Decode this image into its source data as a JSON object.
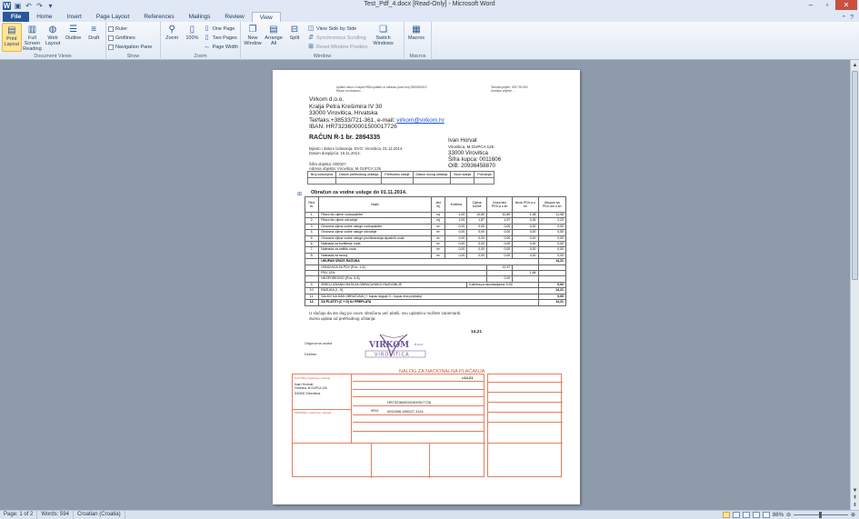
{
  "window": {
    "title": "Test_Pdf_4.docx [Read-Only] - Microsoft Word"
  },
  "tabs": [
    {
      "label": "File"
    },
    {
      "label": "Home"
    },
    {
      "label": "Insert"
    },
    {
      "label": "Page Layout"
    },
    {
      "label": "References"
    },
    {
      "label": "Mailings"
    },
    {
      "label": "Review"
    },
    {
      "label": "View"
    }
  ],
  "ribbon": {
    "document_views": {
      "label": "Document Views",
      "print_layout": "Print Layout",
      "full_screen": "Full Screen Reading",
      "web_layout": "Web Layout",
      "outline": "Outline",
      "draft": "Draft"
    },
    "show": {
      "label": "Show",
      "ruler": "Ruler",
      "gridlines": "Gridlines",
      "navigation": "Navigation Pane"
    },
    "zoom": {
      "label": "Zoom",
      "zoom": "Zoom",
      "percent": "100%",
      "one_page": "One Page",
      "two_pages": "Two Pages",
      "page_width": "Page Width"
    },
    "window": {
      "label": "Window",
      "new_window": "New Window",
      "arrange_all": "Arrange All",
      "split": "Split",
      "side_by_side": "View Side by Side",
      "sync_scroll": "Synchronous Scrolling",
      "reset_pos": "Reset Window Position",
      "switch": "Switch Windows"
    },
    "macros": {
      "label": "Macros",
      "macros": "Macros"
    }
  },
  "doc": {
    "bank_header_1": "Uplatni račun u Kaptol RBA uplatite uz obrascu poziv broj 0500000013",
    "bank_header_2": "Račun za obavezu ...",
    "bank_header_right_1": "Tehnički prijem: 033 700 000",
    "bank_header_right_2": "Uredsko vrijeme ...",
    "company": {
      "name": "Virkom d.o.o.",
      "street": "Kralja Petra Krešimira IV 30",
      "city": "33000 Virovitica, Hrvatska",
      "contact_prefix": "Tel/faks:+38533/721-361, e-mail: ",
      "email": "virkom@virkom.hr",
      "iban": "IBAN: HR7323600001500017726"
    },
    "invoice_title": "RAČUN R-1 br. 2894335",
    "meta_1": "Mjesto i datum izdavanja, DVO: Virovitica, 01.11.2014.",
    "meta_2": "Datum dospijeća: 15.11.2014.",
    "object_1": "Šifra objekta: 000027",
    "object_2": "Adresa objekta: Virovitica, M.GUPCA 126",
    "buyer": {
      "name": "Ivan Horvat",
      "addr": "Virovitica, M.GUPCA 126",
      "city": "33000 Virovitica",
      "code": "Šifra kupca: 0011606",
      "oib": "OIB: 20936458870"
    },
    "meter_headers": [
      "Broj vodomjera",
      "Datum prethodnog očitanja",
      "Prethodno stanje",
      "Datum novog očitanja",
      "Novo stanje",
      "Potrošnja"
    ],
    "section_title": "Obračun za vodne usluge do 01.11.2014.",
    "table": {
      "headers": [
        "Red. br.",
        "Naziv",
        "Jed. mj.",
        "Količina",
        "Cijena kn/JM",
        "Iznos bez PDV-a u kn",
        "Iznos PDV-a u kn",
        "Ukupno sa PDV-om u kn"
      ],
      "rows": [
        [
          "1.",
          "Fiksni dio cijene vodoopskrbe",
          "mj",
          "1,00",
          "10,80",
          "10,80",
          "1,38",
          "11,98"
        ],
        [
          "2.",
          "Fiksni dio cijene odvodnje",
          "mj",
          "1,00",
          "1,87",
          "1,97",
          "0,26",
          "2,23"
        ],
        [
          "3.",
          "Osnovna cijena vodne usluge vodoopskrbe",
          "m³",
          "0,00",
          "0,00",
          "0,00",
          "0,00",
          "0,00"
        ],
        [
          "4.",
          "Osnovna cijena vodne usluge odvodnje",
          "m³",
          "0,00",
          "0,00",
          "0,00",
          "0,00",
          "0,00"
        ],
        [
          "5.",
          "Osnovna cijena vodne usluge pročišćavanja otpadnih voda",
          "m³",
          "0,00",
          "0,00",
          "0,00",
          "0,00",
          "0,00"
        ],
        [
          "6.",
          "Naknada za korištenje voda",
          "m³",
          "0,00",
          "0,00",
          "0,00",
          "0,00",
          "0,00"
        ],
        [
          "7.",
          "Naknada za zaštitu voda",
          "m³",
          "0,00",
          "0,00",
          "0,00",
          "0,00",
          "0,00"
        ],
        [
          "8.",
          "Naknada za razvoj",
          "m³",
          "0,00",
          "0,00",
          "0,00",
          "0,00",
          "0,00"
        ]
      ],
      "subtotal_label": "UKUPAN IZNOS RAČUNA",
      "subtotal_value": "14,21",
      "tax_base_label": "OSNOVICA ZA PDV (R.br. 1-5)",
      "tax_base_value": "12,57",
      "vat_label": "PDV 13%",
      "vat_value": "1,64",
      "nonvat_label": "NEOPOREZIVO (R.br. 6-8)",
      "nonvat_value": "0,00",
      "r9": [
        "9.",
        "ZBROJ IZDANIH RATA ZA OBRAČUNSKO RAZDOBLJE",
        "Količina po akontacijama: 0,00",
        "0,00"
      ],
      "r10": [
        "10.",
        "RAZLIKA (I - 9)",
        "14,21"
      ],
      "r11": [
        "11.",
        "SALDO NA DAN OBRAČUNA ( + kupac duguje II – kupac ima preplatu)",
        "0,00"
      ],
      "r12": [
        "12.",
        "ZA PLATITI (C + D) ILI PREPLATA",
        "14,21"
      ]
    },
    "note_1": "U slučaju da ste dug po ovom obračunu  već platili, ovu uplatnicu  možete zanemariti.",
    "note_2": "Suma uplata od prethodnog  očitanja:",
    "note_total": "14,21",
    "odgovorna": "Odgovorna osoba",
    "direktor": "Direktor",
    "stamp_name": "VIRKOM",
    "stamp_sub": "VIROVITICA",
    "stamp_doo": "d.o.o.",
    "slip": {
      "title": "NALOG ZA NACIONALNA PLAĆANJA",
      "payer_lbl": "PLATITELJ (naziv/ime i adresa)",
      "payer_name": "Ivan Horvat",
      "payer_addr": "Virovitica, M.GUPCA 126",
      "payer_city": "33000 Virovitica",
      "amount": "=14,21",
      "iban_payee": "HR7323600001500017726",
      "model": "HR01",
      "ref": "0011606-000027-1114",
      "payee_lbl": "PRIMATELJ (naziv/ime i adresa)"
    }
  },
  "status": {
    "page": "Page: 1 of 2",
    "words": "Words: 594",
    "language": "Croatian (Croatia)",
    "zoom": "86%"
  }
}
